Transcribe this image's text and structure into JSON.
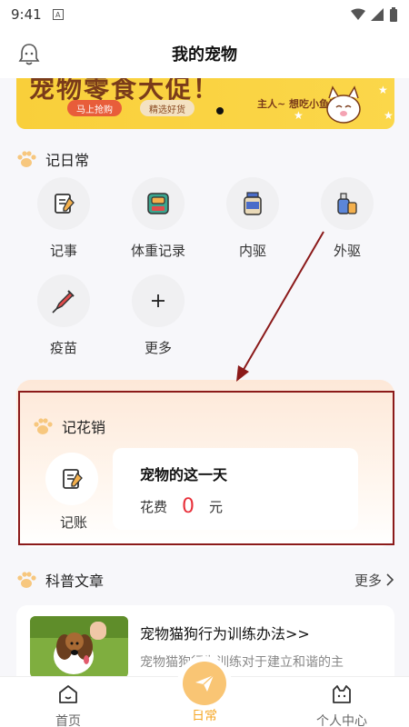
{
  "status": {
    "time": "9:41",
    "sim_label": "A"
  },
  "header": {
    "title": "我的宠物"
  },
  "banner": {
    "headline": "宠物零食大促！",
    "btn_buy": "马上抢购",
    "btn_fine": "精选好货",
    "slogan": "主人~ 想吃小鱼干!"
  },
  "daily": {
    "title": "记日常",
    "items": [
      {
        "label": "记事",
        "icon": "notebook-icon"
      },
      {
        "label": "体重记录",
        "icon": "scale-icon"
      },
      {
        "label": "内驱",
        "icon": "medicine-bottle-icon"
      },
      {
        "label": "外驱",
        "icon": "spray-bottle-icon"
      },
      {
        "label": "疫苗",
        "icon": "syringe-icon"
      },
      {
        "label": "更多",
        "icon": "plus-icon"
      }
    ]
  },
  "spending": {
    "title": "记花销",
    "account_label": "记账",
    "day_title": "宠物的这一天",
    "cost_label": "花费",
    "cost_value": "0",
    "cost_unit": "元"
  },
  "articles": {
    "title": "科普文章",
    "more": "更多",
    "items": [
      {
        "title": "宠物猫狗行为训练办法>>",
        "desc": "宠物猫狗行为训练对于建立和谐的主"
      }
    ]
  },
  "tabs": [
    {
      "label": "首页"
    },
    {
      "label": "日常"
    },
    {
      "label": "个人中心"
    }
  ],
  "colors": {
    "accent": "#f5a623",
    "cost": "#e8303a",
    "highlight": "#8b1a1a"
  }
}
